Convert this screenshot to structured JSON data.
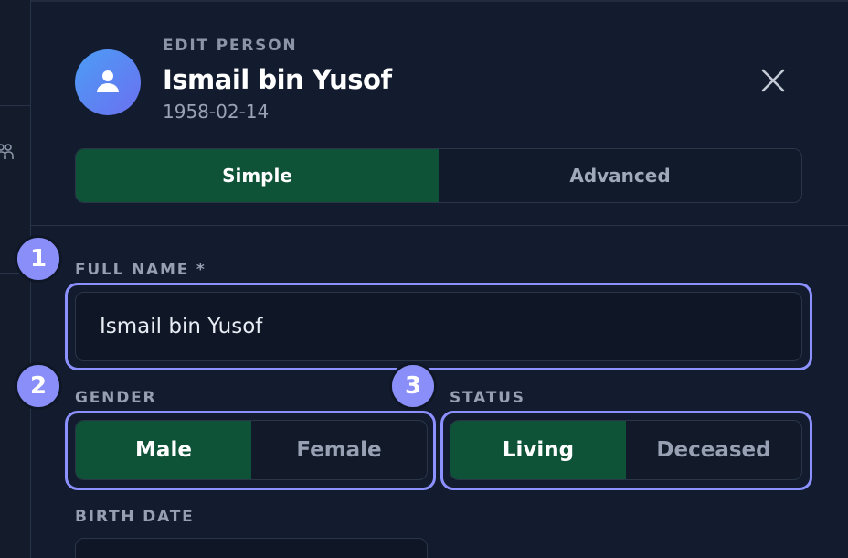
{
  "header": {
    "eyebrow": "EDIT PERSON",
    "name": "Ismail bin Yusof",
    "date": "1958-02-14"
  },
  "mode_tabs": [
    {
      "label": "Simple",
      "active": true
    },
    {
      "label": "Advanced",
      "active": false
    }
  ],
  "form": {
    "full_name": {
      "label": "FULL NAME *",
      "value": "Ismail bin Yusof"
    },
    "gender": {
      "label": "GENDER",
      "options": [
        "Male",
        "Female"
      ],
      "selected": "Male"
    },
    "status": {
      "label": "STATUS",
      "options": [
        "Living",
        "Deceased"
      ],
      "selected": "Living"
    },
    "birth_date": {
      "label": "BIRTH DATE"
    }
  },
  "badges": [
    "1",
    "2",
    "3"
  ],
  "colors": {
    "background": "#131c2e",
    "active_green": "#0e5238",
    "highlight": "#8c91ff",
    "avatar_start": "#4c9df5",
    "avatar_end": "#6b70f0"
  },
  "icons": [
    "people-icon",
    "user-icon",
    "close-icon"
  ]
}
